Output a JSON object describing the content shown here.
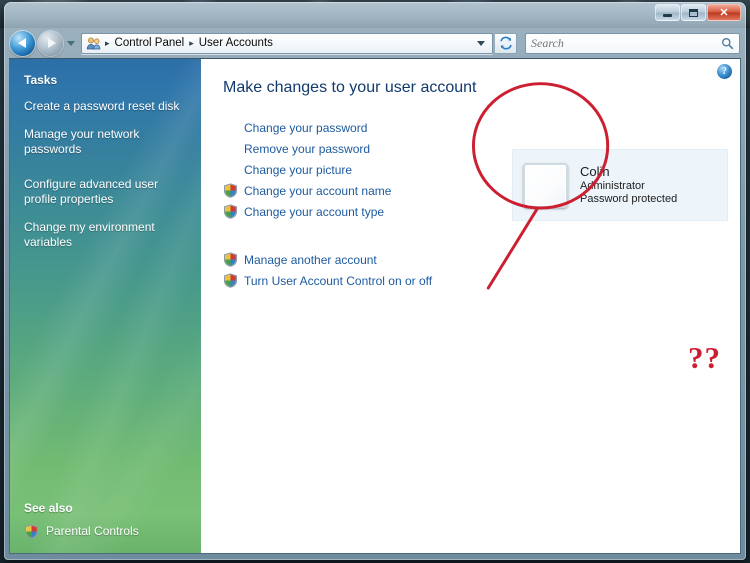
{
  "window": {
    "controls": {
      "minimize_label": "Minimize",
      "maximize_label": "Maximize",
      "close_label": "✕"
    }
  },
  "toolbar": {
    "back_label": "Back",
    "forward_label": "Forward",
    "recent_pages_label": "Recent pages",
    "breadcrumb": [
      "Control Panel",
      "User Accounts"
    ],
    "separator": "▸",
    "address_dropdown_label": "Previous locations",
    "refresh_label": "Refresh",
    "search": {
      "placeholder": "Search",
      "value": "",
      "icon": "search-icon"
    }
  },
  "sidebar": {
    "tasks_heading": "Tasks",
    "tasks": [
      "Create a password reset disk",
      "Manage your network passwords",
      "Configure advanced user profile properties",
      "Change my environment variables"
    ],
    "see_also_heading": "See also",
    "see_also": [
      {
        "label": "Parental Controls",
        "icon": "parental-controls-shield-icon"
      }
    ]
  },
  "content": {
    "help_label": "?",
    "heading": "Make changes to your user account",
    "links_group_1": [
      {
        "label": "Change your password",
        "shield": false
      },
      {
        "label": "Remove your password",
        "shield": false
      },
      {
        "label": "Change your picture",
        "shield": false
      },
      {
        "label": "Change your account name",
        "shield": true
      },
      {
        "label": "Change your account type",
        "shield": true
      }
    ],
    "links_group_2": [
      {
        "label": "Manage another account",
        "shield": true
      },
      {
        "label": "Turn User Account Control on or off",
        "shield": true
      }
    ],
    "account": {
      "avatar_icon": "blank-user-picture",
      "name": "Colin",
      "type": "Administrator",
      "password_status": "Password protected"
    }
  },
  "annotation": {
    "question_marks": "??",
    "color": "#cc1f31",
    "shape": "ellipse-around-account-tile-with-leader-line"
  }
}
